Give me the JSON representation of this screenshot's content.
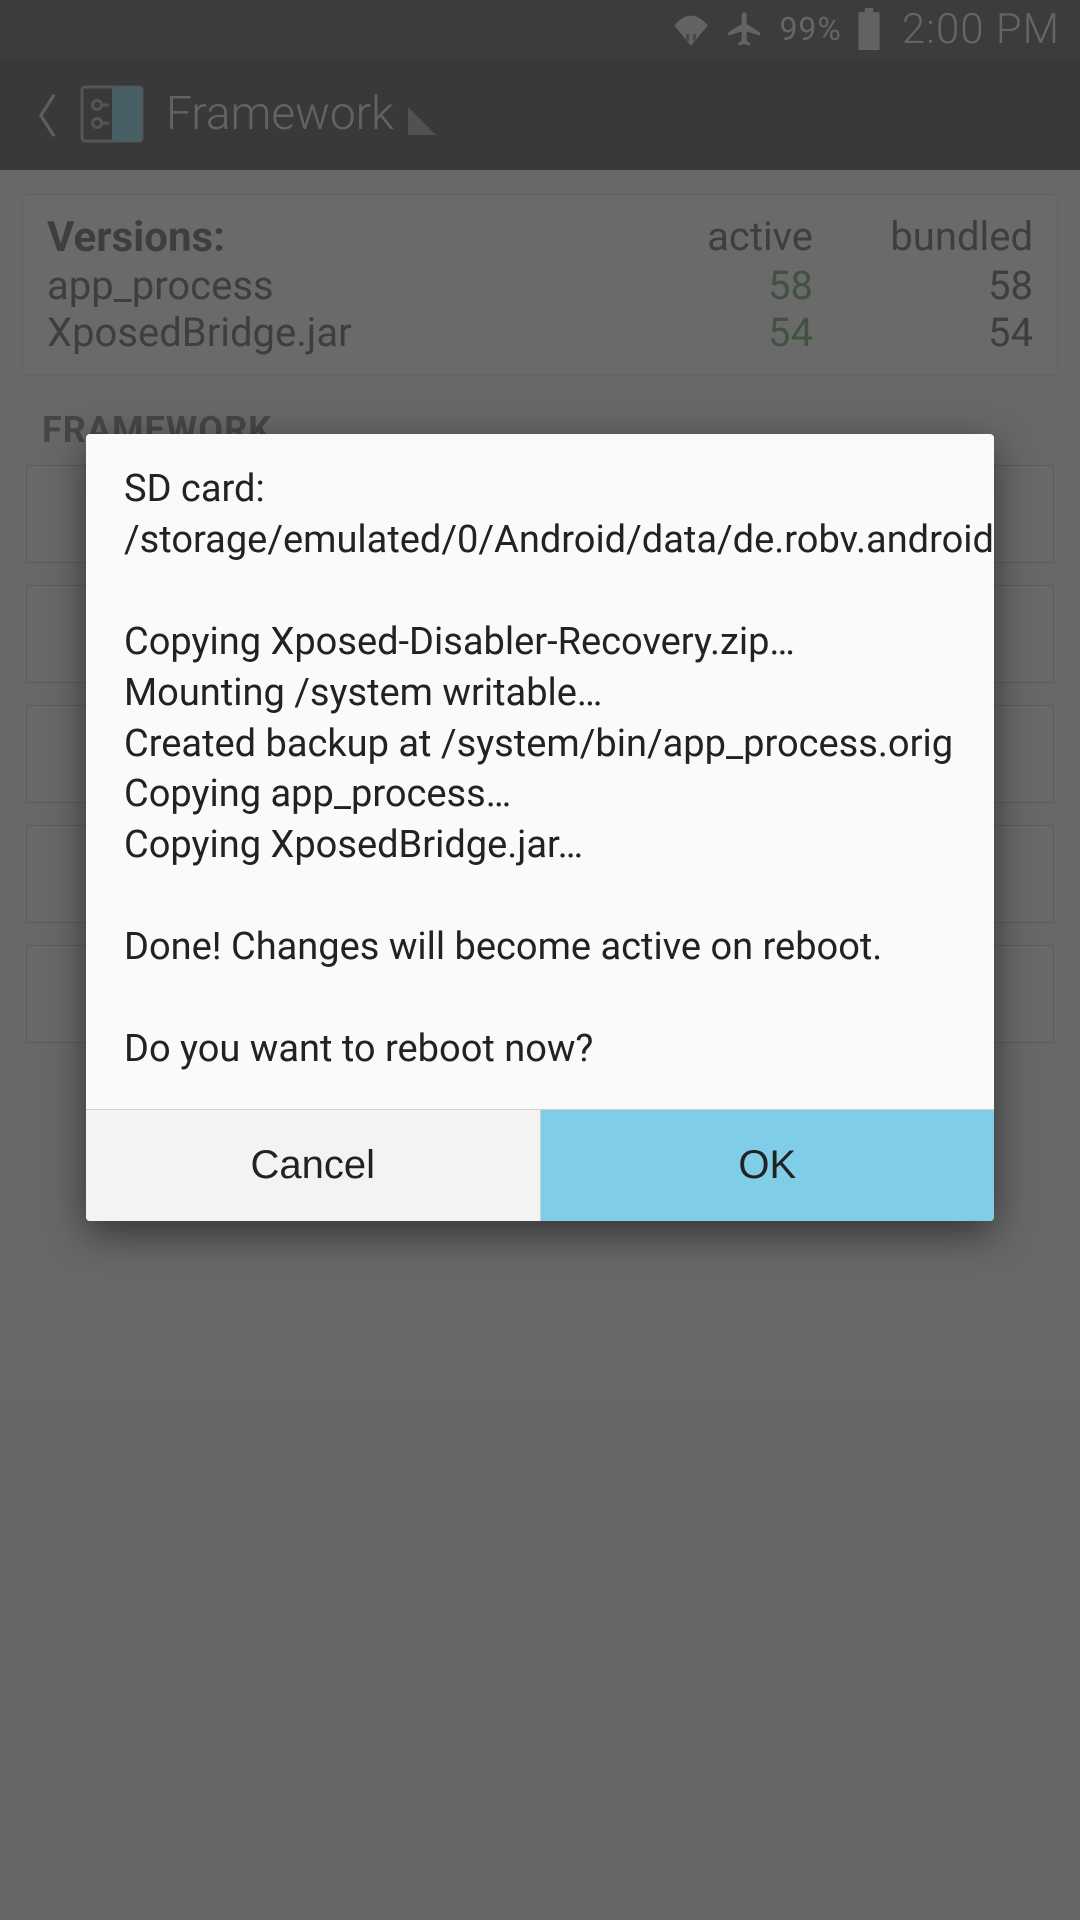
{
  "statusbar": {
    "battery_pct": "99%",
    "clock": "2:00 PM"
  },
  "actionbar": {
    "title": "Framework"
  },
  "versions": {
    "header_label": "Versions:",
    "header_active": "active",
    "header_bundled": "bundled",
    "rows": [
      {
        "label": "app_process",
        "active": "58",
        "bundled": "58"
      },
      {
        "label": "XposedBridge.jar",
        "active": "54",
        "bundled": "54"
      }
    ]
  },
  "section_title": "FRAMEWORK",
  "dialog": {
    "body": "SD card: /storage/emulated/0/Android/data/de.robv.android.xposed.installer/files\n\nCopying Xposed-Disabler-Recovery.zip…\nMounting /system writable…\nCreated backup at /system/bin/app_process.orig\nCopying app_process…\nCopying XposedBridge.jar…\n\nDone! Changes will become active on reboot.\n\nDo you want to reboot now?",
    "cancel": "Cancel",
    "ok": "OK"
  }
}
